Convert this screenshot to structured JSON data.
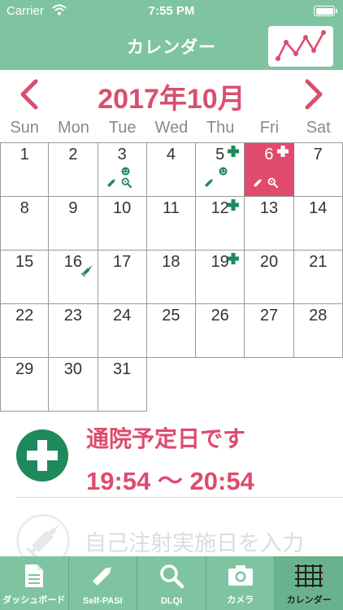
{
  "status_bar": {
    "carrier": "Carrier",
    "time": "7:55 PM"
  },
  "nav": {
    "title": "カレンダー"
  },
  "calendar": {
    "month_title": "2017年10月",
    "weekdays": [
      "Sun",
      "Mon",
      "Tue",
      "Wed",
      "Thu",
      "Fri",
      "Sat"
    ],
    "weeks": [
      [
        "1",
        "2",
        "3",
        "4",
        "5",
        "6",
        "7"
      ],
      [
        "8",
        "9",
        "10",
        "11",
        "12",
        "13",
        "14"
      ],
      [
        "15",
        "16",
        "17",
        "18",
        "19",
        "20",
        "21"
      ],
      [
        "22",
        "23",
        "24",
        "25",
        "26",
        "27",
        "28"
      ],
      [
        "29",
        "30",
        "31",
        "",
        "",
        "",
        ""
      ]
    ],
    "selected_day": "6",
    "marks": {
      "3": [
        "smile-icon",
        "pencil-icon",
        "magnifier-icon"
      ],
      "5": [
        "plus-icon",
        "smile-icon",
        "pencil-icon"
      ],
      "6": [
        "plus-icon",
        "pencil-icon",
        "magnifier-icon"
      ],
      "12": [
        "plus-icon"
      ],
      "16": [
        "syringe-icon"
      ],
      "19": [
        "plus-icon"
      ]
    }
  },
  "event": {
    "title": "通院予定日です",
    "time": "19:54 ～ 20:54"
  },
  "injection": {
    "label": "自己注射実施日を入力"
  },
  "tabs": [
    {
      "label": "ダッシュボード",
      "icon": "document-icon"
    },
    {
      "label": "Self-PASI",
      "icon": "pencil-icon"
    },
    {
      "label": "DLQI",
      "icon": "magnifier-icon"
    },
    {
      "label": "カメラ",
      "icon": "camera-icon"
    },
    {
      "label": "カレンダー",
      "icon": "calendar-grid-icon"
    }
  ],
  "colors": {
    "primary_green": "#7ec4a0",
    "dark_green": "#1e8a5c",
    "accent_pink": "#df4a6d"
  }
}
